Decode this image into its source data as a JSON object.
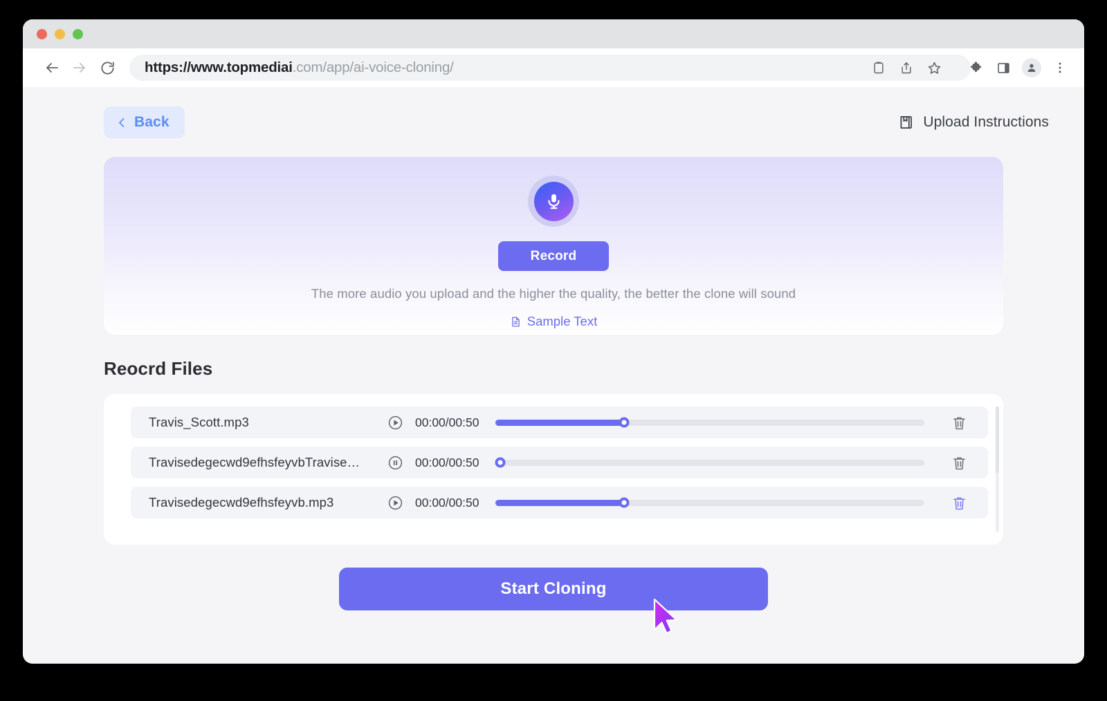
{
  "window": {
    "traffic_lights": [
      "close",
      "minimize",
      "maximize"
    ],
    "colors": {
      "red": "#ec6a5c",
      "yellow": "#f3bd4c",
      "green": "#61c554"
    }
  },
  "browser": {
    "back_icon": "arrow-left-icon",
    "forward_icon": "arrow-right-icon",
    "reload_icon": "reload-icon",
    "url_strong": "https://www.topmediai",
    "url_rest": ".com/app/ai-voice-cloning/",
    "toolbar_icons": [
      "clipboard-icon",
      "share-icon",
      "star-icon",
      "extensions-icon",
      "side-panel-icon",
      "profile-avatar-icon",
      "more-menu-icon"
    ]
  },
  "header": {
    "back_label": "Back",
    "back_icon": "chevron-left-icon",
    "upload_instructions_label": "Upload Instructions",
    "upload_instructions_icon": "manual-book-icon"
  },
  "record_card": {
    "mic_icon": "microphone-icon",
    "record_label": "Record",
    "hint": "The more audio you upload and the higher the quality, the better the clone will sound",
    "sample_link_label": "Sample Text",
    "sample_link_icon": "document-icon"
  },
  "files_section": {
    "title": "Reocrd Files",
    "rows": [
      {
        "name": "Travis_Scott.mp3",
        "transport_icon": "play-icon",
        "time": "00:00/00:50",
        "progress_percent": 30,
        "delete_icon": "trash-icon",
        "delete_active": false
      },
      {
        "name": "Travisedegecwd9efhsfeyvbTravise…",
        "transport_icon": "pause-icon",
        "time": "00:00/00:50",
        "progress_percent": 1,
        "delete_icon": "trash-icon",
        "delete_active": false
      },
      {
        "name": "Travisedegecwd9efhsfeyvb.mp3",
        "transport_icon": "play-icon",
        "time": "00:00/00:50",
        "progress_percent": 30,
        "delete_icon": "trash-icon",
        "delete_active": true
      }
    ]
  },
  "footer": {
    "start_label": "Start Cloning"
  },
  "cursor": {
    "icon": "arrow-pointer-cursor"
  },
  "colors": {
    "accent": "#6b6cf0",
    "accent_light": "#e3eafd",
    "link": "#5b8cf7",
    "page_bg": "#f5f5f7",
    "row_bg": "#f3f4f8",
    "cursor_from": "#d42af0",
    "cursor_to": "#8b3ef0"
  }
}
